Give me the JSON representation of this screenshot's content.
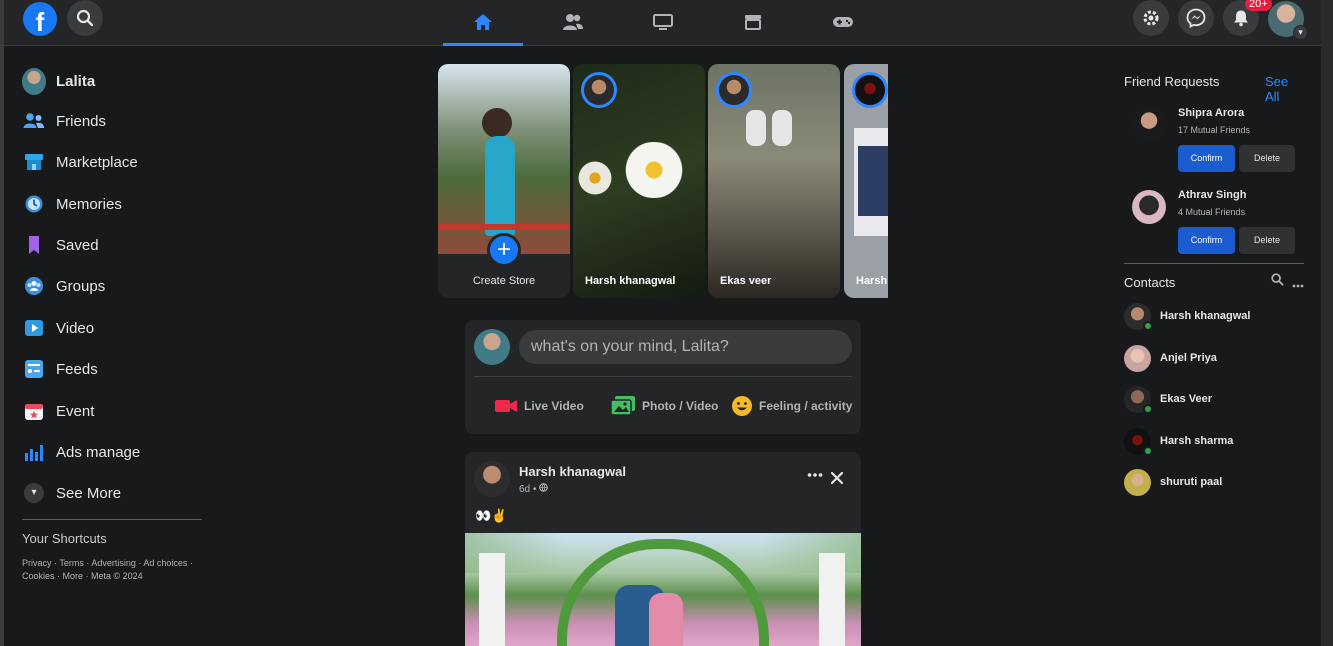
{
  "topbar": {
    "logo": "f",
    "notifications_badge": "20+",
    "icons": [
      "search-icon",
      "home-icon",
      "friends-icon",
      "watch-icon",
      "marketplace-icon",
      "gaming-icon",
      "settings-icon",
      "messenger-icon",
      "bell-icon"
    ]
  },
  "sidebar": {
    "user_name": "Lalita",
    "items": [
      {
        "label": "Friends",
        "icon": "friends-icon"
      },
      {
        "label": "Marketplace",
        "icon": "marketplace-icon"
      },
      {
        "label": "Memories",
        "icon": "memories-icon"
      },
      {
        "label": "Saved",
        "icon": "bookmark-icon"
      },
      {
        "label": "Groups",
        "icon": "groups-icon"
      },
      {
        "label": "Video",
        "icon": "video-icon"
      },
      {
        "label": "Feeds",
        "icon": "feeds-icon"
      },
      {
        "label": "Event",
        "icon": "event-icon"
      },
      {
        "label": "Ads manage",
        "icon": "ads-icon"
      },
      {
        "label": "See More",
        "icon": "chevron-down-icon"
      }
    ],
    "shortcuts_title": "Your Shortcuts",
    "footer_line1": "Privacy · Terms · Advertising · Ad choices ·",
    "footer_line2": "Cookies · More · Meta © 2024"
  },
  "stories": [
    {
      "name": "Create Store"
    },
    {
      "name": "Harsh khanagwal"
    },
    {
      "name": "Ekas veer"
    },
    {
      "name": "Harsh"
    }
  ],
  "composer": {
    "placeholder": "what's on your mind, Lalita?",
    "actions": [
      {
        "label": "Live Video",
        "icon": "live-video-icon",
        "color": "#f02849"
      },
      {
        "label": "Photo / Video",
        "icon": "photo-icon",
        "color": "#45bd62"
      },
      {
        "label": "Feeling / activity",
        "icon": "feeling-icon",
        "color": "#f7b928"
      }
    ]
  },
  "post": {
    "author": "Harsh khanagwal",
    "time": "6d",
    "caption": "👀✌️"
  },
  "right": {
    "requests_title": "Friend Requests",
    "see_all": "See All",
    "requests": [
      {
        "name": "Shipra Arora",
        "mutual": "17 Mutual Friends",
        "confirm": "Confirm",
        "delete": "Delete"
      },
      {
        "name": "Athrav Singh",
        "mutual": "4 Mutual Friends",
        "confirm": "Confirm",
        "delete": "Delete"
      }
    ],
    "contacts_title": "Contacts",
    "contacts": [
      {
        "name": "Harsh khanagwal",
        "online": true
      },
      {
        "name": "Anjel Priya",
        "online": false
      },
      {
        "name": "Ekas Veer",
        "online": true
      },
      {
        "name": "Harsh sharma",
        "online": true
      },
      {
        "name": "shuruti paal",
        "online": false
      }
    ]
  },
  "colors": {
    "accent": "#2d88ff",
    "background": "#18191a",
    "surface": "#242526",
    "confirm": "#1b5cd1",
    "online": "#31a24c",
    "badge": "#e41e3f"
  }
}
